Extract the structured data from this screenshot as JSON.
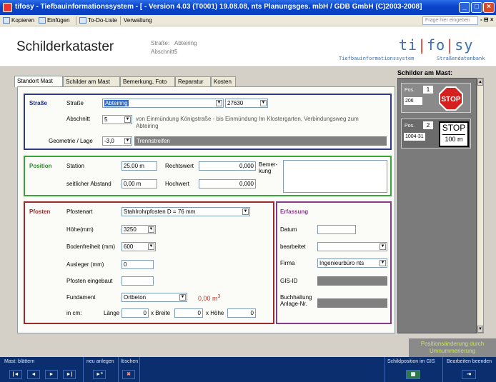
{
  "window": {
    "title": "tifosy - Tiefbauinformationssystem - [ - Version 4.03 (T0001) 19.08.08, nts Planungsges. mbH / GDB GmbH (C)2003-2008]",
    "btn_min": "_",
    "btn_max": "□",
    "btn_close": "×"
  },
  "toolbar": {
    "copy": "Kopieren",
    "paste": "Einfügen",
    "todo": "To-Do-Liste",
    "admin": "Verwaltung",
    "help_placeholder": "Frage hier eingeben",
    "right_controls": "- ⊟ ×"
  },
  "header": {
    "title": "Schilderkataster",
    "street_label": "Straße:",
    "street_value": "Abteiring",
    "section_label": "Abschnitt:",
    "section_value": "5",
    "logo_a": "ti",
    "logo_b": "fo",
    "logo_c": "sy",
    "logo_bar": "|",
    "logo_sub1": "Tiefbauinformationssystem",
    "logo_sub2": "Straßendatenbank"
  },
  "tabs": [
    "Standort Mast",
    "Schilder am Mast",
    "Bemerkung, Foto",
    "Reparatur",
    "Kosten"
  ],
  "strasse": {
    "title": "Straße",
    "street_label": "Straße",
    "street_value": "Abteiring",
    "street_code": "27630",
    "section_label": "Abschnitt",
    "section_value": "5",
    "section_desc": "von Einmündung Königstraße  -  bis  Einmündung Im Klostergarten, Verbindungsweg zum Abteiring",
    "geo_label": "Geometrie / Lage",
    "geo_value": "-3,0",
    "geo_desc": "Trennstreifen"
  },
  "position": {
    "title": "Position",
    "station_label": "Station",
    "station_value": "25,00 m",
    "rechts_label": "Rechtswert",
    "rechts_value": "0,000",
    "abstand_label": "seitlicher Abstand",
    "abstand_value": "0,00 m",
    "hoch_label": "Hochwert",
    "hoch_value": "0,000",
    "bemerkung_label1": "Bemer-",
    "bemerkung_label2": "kung"
  },
  "pfosten": {
    "title": "Pfosten",
    "art_label": "Pfostenart",
    "art_value": "Stahlrohrpfosten D =  76 mm",
    "hoehe_label": "Höhe(mm)",
    "hoehe_value": "3250",
    "boden_label": "Bodenfreiheit (mm)",
    "boden_value": "600",
    "ausleger_label": "Ausleger (mm)",
    "ausleger_value": "0",
    "eingebaut_label": "Pfosten eingebaut",
    "eingebaut_value": "",
    "fundament_label": "Fundament",
    "fundament_value": "Ortbeton",
    "fundament_volume": "0,00 m",
    "fundament_exp": "3",
    "incm_label": "in cm:",
    "laenge_label": "Länge",
    "laenge_value": "0",
    "breite_label": "x Breite",
    "breite_value": "0",
    "hoehe2_label": "x Höhe",
    "hoehe2_value": "0"
  },
  "erfassung": {
    "title": "Erfassung",
    "datum_label": "Datum",
    "datum_value": "",
    "bearbeitet_label": "bearbeitet",
    "bearbeitet_value": "",
    "firma_label": "Firma",
    "firma_value": "Ingenieurbüro nts",
    "gisid_label": "GIS-ID",
    "buch_label1": "Buchhaltung",
    "buch_label2": "Anlage-Nr."
  },
  "signs": {
    "title": "Schilder am Mast:",
    "items": [
      {
        "pos_label": "Pos.",
        "pos": "1",
        "code": "206",
        "sign_text": "STOP"
      },
      {
        "pos_label": "Pos.",
        "pos": "2",
        "code": "1004-31",
        "sign_text1": "STOP",
        "sign_text2": "100 m"
      }
    ],
    "note1": "Positionsänderung durch",
    "note2": "Umnummerierung"
  },
  "bottom": {
    "browse_label": "Mast: blättern",
    "new_label": "neu anlegen",
    "delete_label": "löschen",
    "gis_label": "Schildposition im GIS",
    "exit_label": "Bearbeiten beenden",
    "first": "|◄",
    "prev": "◄",
    "next": "►",
    "last": "►|",
    "new": "►*",
    "del": "✖"
  },
  "colors": {
    "strasse_border": "#2e3a8c",
    "position_border": "#3aa63a",
    "pfosten_border": "#9b2b2b",
    "erfassung_border": "#8a3a8a",
    "strasse_title": "#1a2a8a",
    "position_title": "#2a8a2a",
    "pfosten_title": "#9b2b2b",
    "erfassung_title": "#8a3a8a"
  }
}
